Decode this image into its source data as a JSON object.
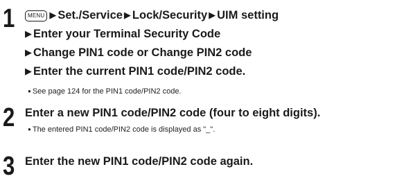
{
  "steps": [
    {
      "number": "1",
      "menu_key": "MENU",
      "line1": [
        "Set./Service",
        "Lock/Security",
        "UIM setting"
      ],
      "line2": "Enter your Terminal Security Code",
      "line3": "Change PIN1 code or Change PIN2 code",
      "line4": "Enter the current PIN1 code/PIN2 code.",
      "note": "See page 124 for the PIN1 code/PIN2 code."
    },
    {
      "number": "2",
      "line1": "Enter a new PIN1 code/PIN2 code (four to eight digits).",
      "note": "The entered PIN1 code/PIN2 code is displayed as \"_\"."
    },
    {
      "number": "3",
      "line1": "Enter the new PIN1 code/PIN2 code again."
    }
  ],
  "icons": {
    "arrow": "right-triangle-icon",
    "bullet": "bullet-dot-icon",
    "menu": "menu-key-icon"
  }
}
